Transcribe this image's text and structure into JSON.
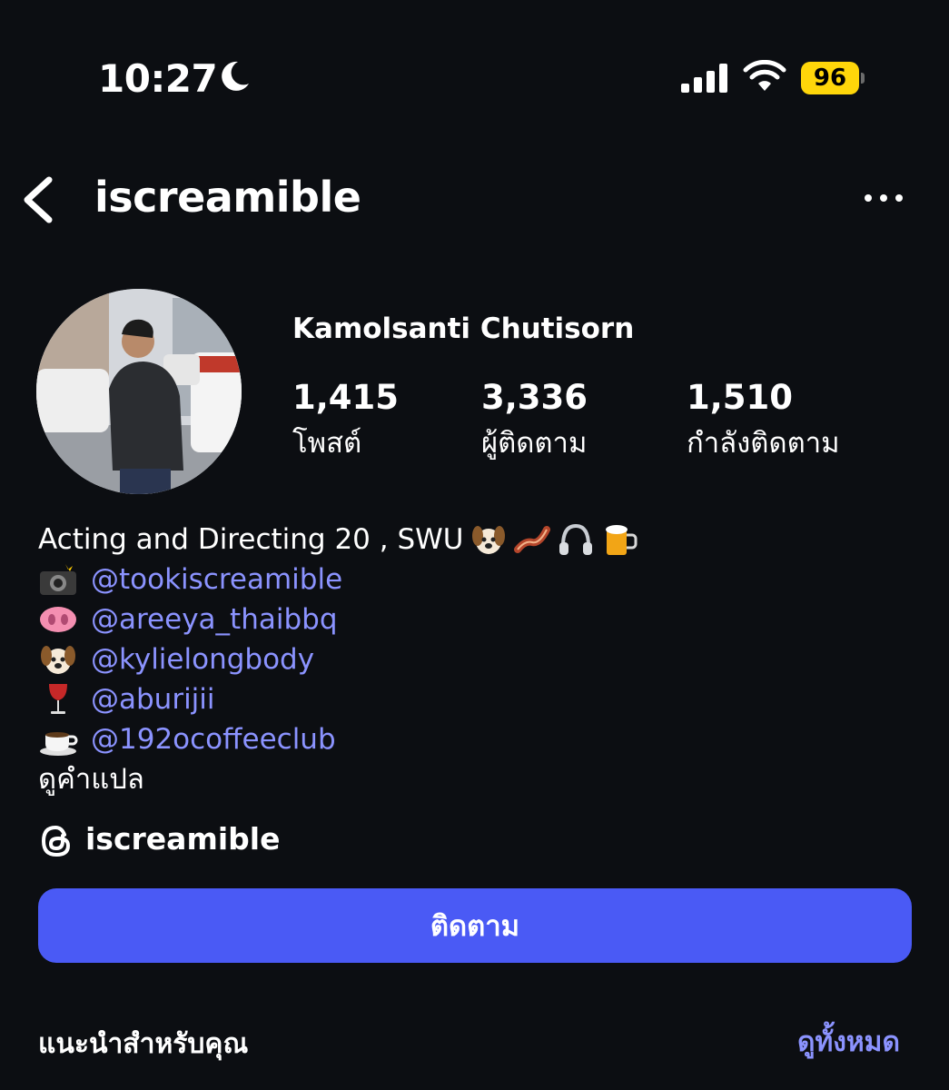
{
  "status_bar": {
    "time": "10:27",
    "battery": "96",
    "icons": [
      "moon-icon",
      "cellular-signal-icon",
      "wifi-icon",
      "battery-icon"
    ],
    "battery_color": "#ffd60a"
  },
  "header": {
    "username": "iscreamible",
    "back_icon": "chevron-left-icon",
    "more_icon": "more-horizontal-icon"
  },
  "profile": {
    "full_name": "Kamolsanti Chutisorn",
    "avatar_icon": "profile-photo",
    "stats": [
      {
        "value": "1,415",
        "label": "โพสต์"
      },
      {
        "value": "3,336",
        "label": "ผู้ติดตาม"
      },
      {
        "value": "1,510",
        "label": "กำลังติดตาม"
      }
    ]
  },
  "bio": {
    "line1": "Acting and Directing 20 , SWU",
    "line1_emojis": [
      "dog-face-emoji",
      "bacon-emoji",
      "headphones-emoji",
      "beer-mug-emoji"
    ],
    "links": [
      {
        "emoji": "camera-flash-emoji",
        "handle": "@tookiscreamible"
      },
      {
        "emoji": "pig-nose-emoji",
        "handle": "@areeya_thaibbq"
      },
      {
        "emoji": "dog-face-emoji",
        "handle": "@kylielongbody"
      },
      {
        "emoji": "wine-glass-emoji",
        "handle": "@aburijii"
      },
      {
        "emoji": "coffee-emoji",
        "handle": "@192ocoffeeclub"
      }
    ],
    "translate": "ดูคำแปล"
  },
  "threads": {
    "icon": "threads-icon",
    "name": "iscreamible"
  },
  "actions": {
    "follow_label": "ติดตาม",
    "accent_color": "#4a5af5"
  },
  "suggestions": {
    "title": "แนะนำสำหรับคุณ",
    "see_all": "ดูทั้งหมด",
    "link_color": "#8b93ff"
  }
}
